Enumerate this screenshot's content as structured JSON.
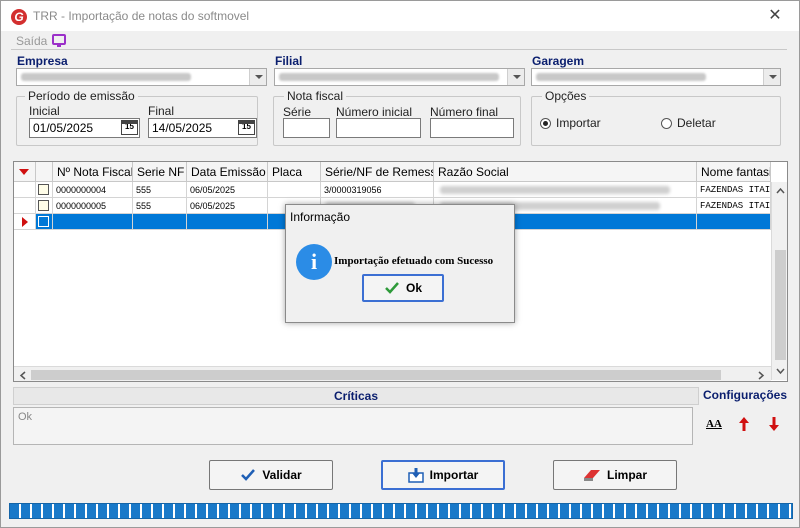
{
  "window": {
    "title": "TRR - Importação de notas do softmovel",
    "close_glyph": "✕",
    "logo_letter": "G"
  },
  "menu": {
    "saida": "Saída"
  },
  "empresa": {
    "label": "Empresa"
  },
  "filial": {
    "label": "Filial"
  },
  "garagem": {
    "label": "Garagem"
  },
  "periodo": {
    "title": "Período de emissão",
    "inicial_label": "Inicial",
    "inicial_value": "01/05/2025",
    "final_label": "Final",
    "final_value": "14/05/2025",
    "cal_glyph": "15"
  },
  "nota_fiscal": {
    "title": "Nota fiscal",
    "serie_label": "Série",
    "numero_inicial_label": "Número inicial",
    "numero_final_label": "Número final"
  },
  "opcoes": {
    "title": "Opções",
    "importar": "Importar",
    "deletar": "Deletar"
  },
  "grid": {
    "columns": [
      "Nº Nota Fiscal",
      "Serie NF",
      "Data Emissão",
      "Placa",
      "Série/NF de Remessa",
      "Razão Social",
      "Nome fantasia"
    ],
    "rows": [
      {
        "nota": "0000000004",
        "serie": "555",
        "data": "06/05/2025",
        "placa": "",
        "remessa": "3/0000319056",
        "razao": "",
        "fantasia": "FAZENDAS ITAI"
      },
      {
        "nota": "0000000005",
        "serie": "555",
        "data": "06/05/2025",
        "placa": "",
        "remessa": "",
        "razao": "",
        "fantasia": "FAZENDAS ITAI"
      },
      {
        "nota": "",
        "serie": "",
        "data": "",
        "placa": "",
        "remessa": "",
        "razao": "",
        "fantasia": ""
      }
    ]
  },
  "criticas": {
    "title": "Críticas",
    "text": "Ok"
  },
  "configuracoes": {
    "title": "Configurações",
    "font_glyph": "A͟A"
  },
  "buttons": {
    "validar": "Validar",
    "importar": "Importar",
    "limpar": "Limpar"
  },
  "dialog": {
    "title": "Informação",
    "message": "Importação efetuado com Sucesso",
    "ok": "Ok",
    "icon_letter": "i"
  },
  "colors": {
    "accent": "#0078d7",
    "label_blue": "#0a1e6e",
    "progress": "#1979c9",
    "arrow_red": "#d01010"
  }
}
